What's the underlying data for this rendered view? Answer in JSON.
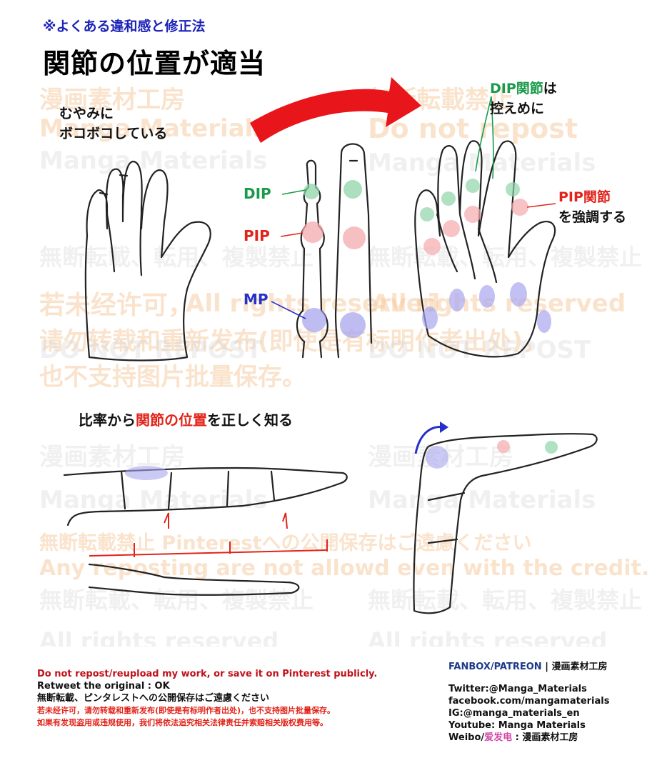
{
  "header": {
    "subtitle": "※よくある違和感と修正法",
    "title": "関節の位置が適当"
  },
  "notes": {
    "bumpy_line1": "むやみに",
    "bumpy_line2": "ボコボコしている",
    "dip_suffix": "は",
    "dip_line2": "控えめに",
    "pip_line2": "を強調する"
  },
  "labels": {
    "dip": "DIP",
    "pip": "PIP",
    "mp": "MP",
    "dip_joint": "DIP関節",
    "pip_joint": "PIP関節"
  },
  "section2": {
    "prefix": "比率から",
    "highlight": "関節の位置",
    "suffix": "を正しく知る"
  },
  "watermarks": {
    "studio_jp": "漫画素材工房",
    "manga_materials": "Manga Materials",
    "no_repost_jp": "無断転載禁止",
    "do_not_repost": "Do not repost",
    "no_repost_jp2": "無断転載、転用、複製禁止",
    "cn_line1": "若未经许可，",
    "cn_line2": "请勿转载和重新发布(即使是有标明作者出处)，",
    "cn_line3": "也不支持图片批量保存。",
    "all_rights": "All rights reserved",
    "pinterest_jp": "無断転載禁止 Pinterestへの公開保存はご遠慮ください",
    "any_reposting": "Any reposting are not allowd even with the credit.",
    "do_not_repost_caps": "DO NOT REPOST"
  },
  "footer": {
    "left": {
      "line1": "Do not repost/reupload my work, or save it on Pinterest publicly.",
      "line2": "Retweet the original : OK",
      "line3": "無断転載、ピンタレストへの公開保存はご遠慮ください",
      "line4": "若未经许可，请勿转载和重新发布(即使是有标明作者出处)，也不支持图片批量保存。",
      "line5": "如果有发现盗用或违规使用，我们将依法追究相关法律责任并索赔相关版权费用等。"
    },
    "right": {
      "fanbox": "FANBOX/PATREON",
      "sep": " | ",
      "studio": "漫画素材工房",
      "twitter": "Twitter:@Manga_Materials",
      "facebook": "facebook.com/mangamaterials",
      "ig": "IG:@manga_materials_en",
      "youtube": "Youtube: Manga Materials",
      "weibo_prefix": "Weibo/",
      "weibo_name": "爱发电",
      "weibo_suffix": " : 漫画素材工房"
    }
  },
  "colors": {
    "dip": "#8fd4a8",
    "pip": "#f3a9ad",
    "mp": "#a9a6ee",
    "arrow": "#e8151a"
  }
}
